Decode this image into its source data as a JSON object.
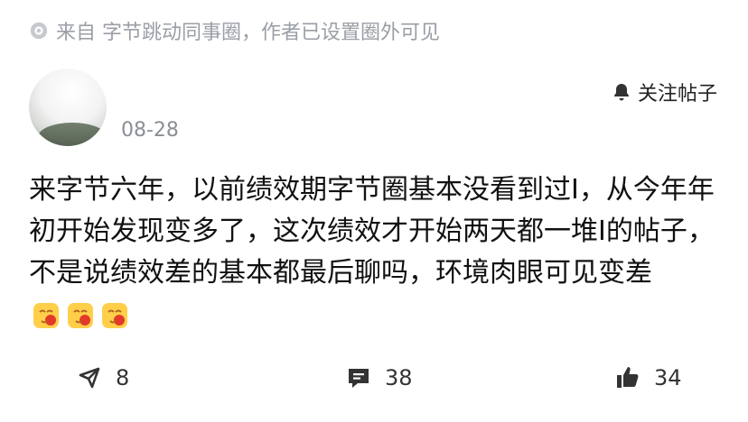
{
  "source": {
    "text": "来自 字节跳动同事圈，作者已设置圈外可见",
    "icon": "broadcast-icon"
  },
  "post": {
    "author_name": " ",
    "date": "08-28",
    "follow_label": "关注帖子",
    "content": "来字节六年，以前绩效期字节圈基本没看到过I，从今年年初开始发现变多了，这次绩效才开始两天都一堆I的帖子，不是说绩效差的基本都最后聊吗，环境肉眼可见变差",
    "emojis": [
      "crying-face-emoji",
      "crying-face-emoji",
      "crying-face-emoji"
    ]
  },
  "actions": {
    "share": {
      "count": "8",
      "icon": "share-icon"
    },
    "comment": {
      "count": "38",
      "icon": "comment-icon"
    },
    "like": {
      "count": "34",
      "icon": "thumbs-up-icon"
    }
  },
  "colors": {
    "muted": "#9a9ea6",
    "text": "#111111",
    "emoji_face": "#ffcf4a",
    "emoji_accent": "#e23a2a"
  }
}
